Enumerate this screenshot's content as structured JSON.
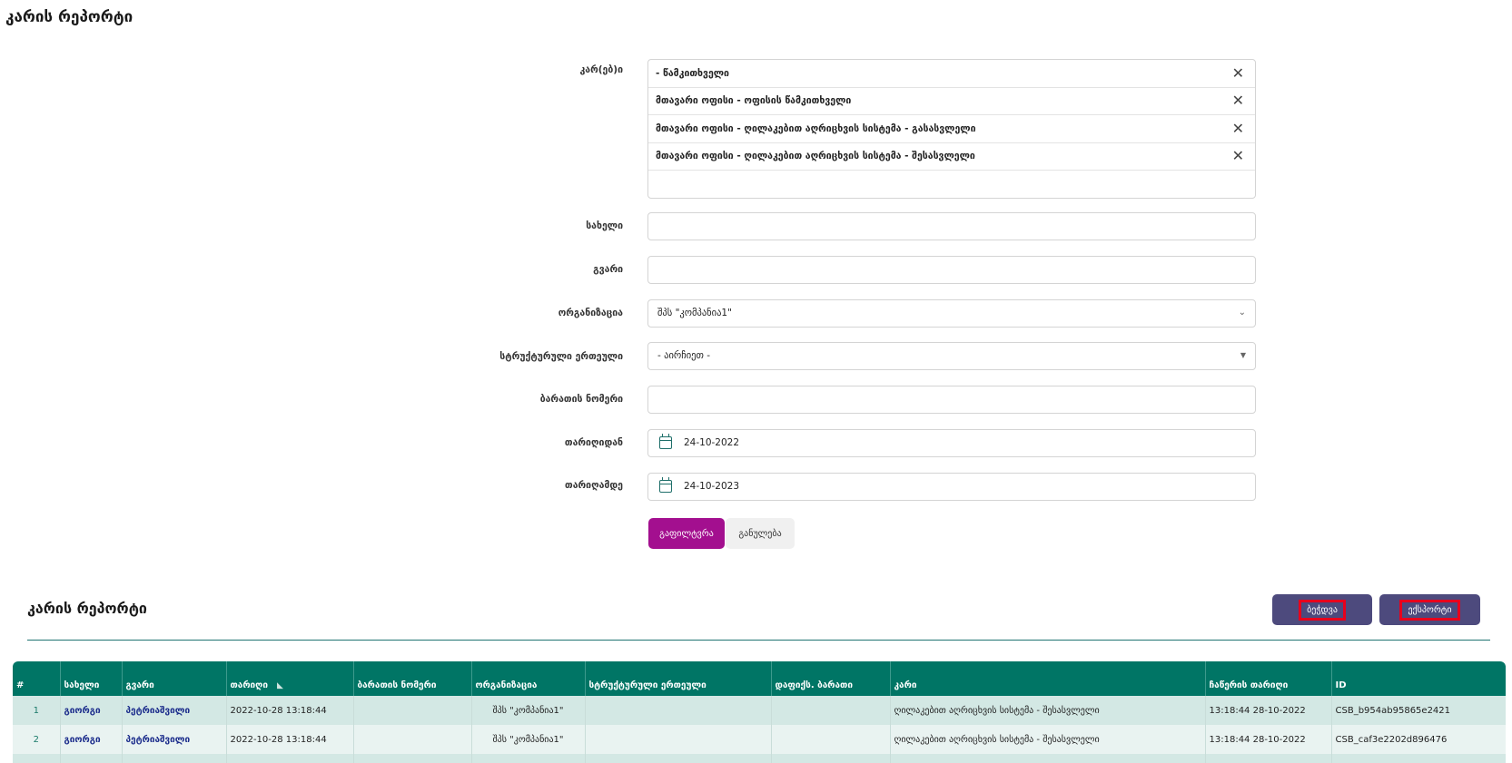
{
  "page": {
    "title": "კარის რეპორტი"
  },
  "filters": {
    "doors_label": "კარ(ებ)ი",
    "doors_selected": [
      "- წამკითხველი",
      "მთავარი ოფისი - ოფისის წამკითხველი",
      "მთავარი ოფისი - ღილაკებით აღრიცხვის სისტემა - გასასვლელი",
      "მთავარი ოფისი - ღილაკებით აღრიცხვის სისტემა - შესასვლელი"
    ],
    "name_label": "სახელი",
    "name_value": "",
    "surname_label": "გვარი",
    "surname_value": "",
    "org_label": "ორგანიზაცია",
    "org_value": "შპს \"კომპანია1\"",
    "struct_label": "სტრუქტურული ერთეული",
    "struct_value": "- აირჩიეთ -",
    "card_label": "ბარათის ნომერი",
    "card_value": "",
    "date_from_label": "თარიღიდან",
    "date_from_value": "24-10-2022",
    "date_to_label": "თარიღამდე",
    "date_to_value": "24-10-2023",
    "filter_button": "გაფილტვრა",
    "clear_button": "განულება"
  },
  "report": {
    "title": "კარის რეპორტი",
    "print_button": "ბეჭდვა",
    "export_button": "ექსპორტი",
    "columns": [
      "#",
      "სახელი",
      "გვარი",
      "თარიღი",
      "ბარათის ნომერი",
      "ორგანიზაცია",
      "სტრუქტურული ერთეული",
      "დაფიქს. ბარათი",
      "კარი",
      "ჩაწერის თარიღი",
      "ID"
    ],
    "rows": [
      [
        "1",
        "გიორგი",
        "პეტრიაშვილი",
        "2022-10-28 13:18:44",
        "",
        "შპს \"კომპანია1\"",
        "",
        "",
        "ღილაკებით აღრიცხვის სისტემა - შესასვლელი",
        "13:18:44 28-10-2022",
        "CSB_b954ab95865e2421"
      ],
      [
        "2",
        "გიორგი",
        "პეტრიაშვილი",
        "2022-10-28 13:18:44",
        "",
        "შპს \"კომპანია1\"",
        "",
        "",
        "ღილაკებით აღრიცხვის სისტემა - შესასვლელი",
        "13:18:44 28-10-2022",
        "CSB_caf3e2202d896476"
      ]
    ]
  },
  "colors": {
    "primary_teal": "#007565",
    "filter_magenta": "#a30f8f",
    "action_purple": "#4d4a7d",
    "highlight_red": "#e8001c"
  }
}
